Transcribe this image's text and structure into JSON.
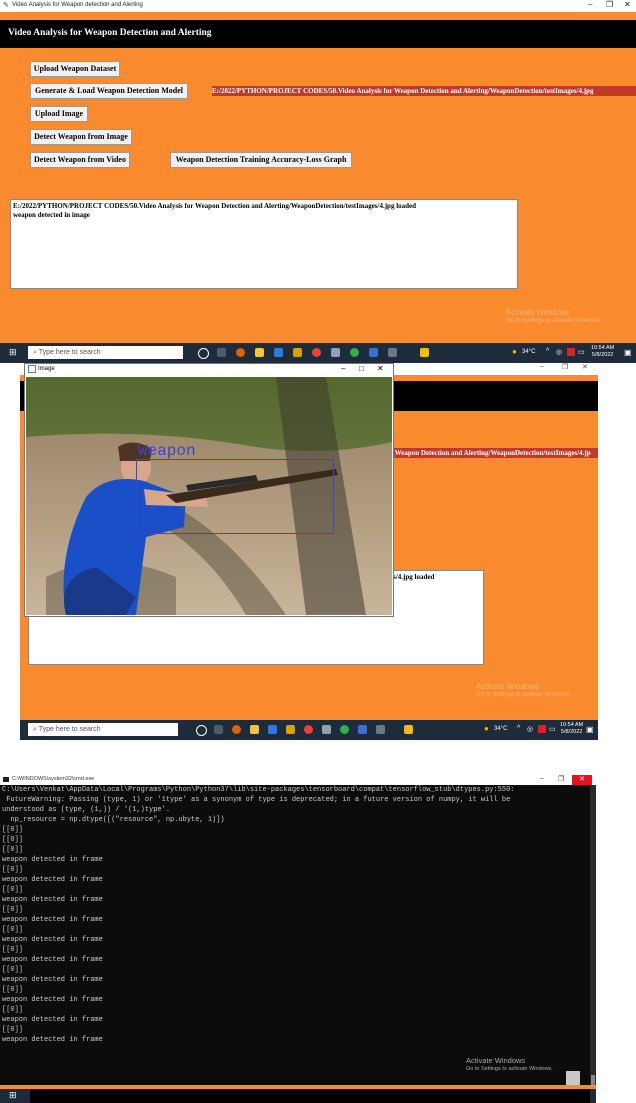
{
  "window1": {
    "title": "Video Analysis for Weapon detection and Alerting",
    "app_header": "Video Analysis for Weapon Detection and Alerting",
    "buttons": {
      "upload_dataset": "Upload Weapon Dataset",
      "generate_model": "Generate & Load Weapon Detection Model",
      "upload_image": "Upload Image",
      "detect_image": "Detect Weapon from Image",
      "detect_video": "Detect Weapon from Video",
      "graph": "Weapon Detection Training Accuracy-Loss Graph"
    },
    "path_label": "E:/2022/PYTHON/PROJECT CODES/50.Video Analysis for Weapon Detection and Alerting/WeaponDetection/testImages/4.jpg",
    "output_line1": "E:/2022/PYTHON/PROJECT CODES/50.Video Analysis for Weapon Detection and Alerting/WeaponDetection/testImages/4.jpg loaded",
    "output_line2": "weapon detected in image",
    "watermark_title": "Activate Windows",
    "watermark_sub": "Go to Settings to activate Windows.",
    "taskbar": {
      "search_placeholder": "Type here to search",
      "weather": "34°C",
      "time": "10:54 AM",
      "date": "5/8/2022"
    }
  },
  "window2": {
    "image_title": "Image",
    "detection_label": "Weapon",
    "behind_path": "r Weapon Detection and Alerting/WeaponDetection/testImages/4.jp",
    "behind_output": "ages/4.jpg loaded",
    "watermark_title": "Activate Windows",
    "watermark_sub": "Go to Settings to activate Windows.",
    "taskbar": {
      "search_placeholder": "Type here to search",
      "weather": "34°C",
      "time": "10:54 AM",
      "date": "5/8/2022"
    }
  },
  "window3": {
    "title": "C:\\WINDOWS\\system32\\cmd.exe",
    "lines": [
      "C:\\Users\\Venkat\\AppData\\Local\\Programs\\Python\\Python37\\lib\\site-packages\\tensorboard\\compat\\tensorflow_stub\\dtypes.py:550:",
      " FutureWarning: Passing (type, 1) or '1type' as a synonym of type is deprecated; in a future version of numpy, it will be",
      "understood as (type, (1,)) / '(1,)type'.",
      "  np_resource = np.dtype([(\"resource\", np.ubyte, 1)])",
      "[[0]]",
      "[[0]]",
      "[[0]]",
      "weapon detected in frame",
      "[[0]]",
      "weapon detected in frame",
      "[[0]]",
      "weapon detected in frame",
      "[[0]]",
      "weapon detected in frame",
      "[[0]]",
      "weapon detected in frame",
      "[[0]]",
      "weapon detected in frame",
      "[[0]]",
      "weapon detected in frame",
      "[[0]]",
      "weapon detected in frame",
      "[[0]]",
      "weapon detected in frame",
      "[[0]]",
      "weapon detected in frame"
    ],
    "watermark_title": "Activate Windows",
    "watermark_sub": "Go to Settings to activate Windows."
  },
  "colors": {
    "orange": "#f98a2e",
    "path_red": "#c0392b",
    "taskbar": "#1d2b3a",
    "detect_box": "#3b46c9"
  }
}
